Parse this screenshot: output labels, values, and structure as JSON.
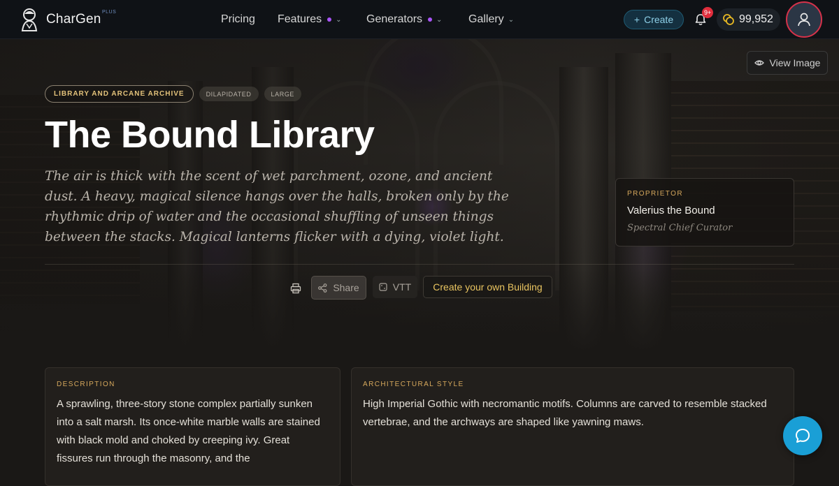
{
  "nav": {
    "logo_text": "CharGen",
    "logo_badge": "PLUS",
    "menu": [
      {
        "label": "Pricing"
      },
      {
        "label": "Features"
      },
      {
        "label": "Generators"
      },
      {
        "label": "Gallery"
      }
    ],
    "create_label": "Create",
    "notifications_badge": "9+",
    "coins": "99,952"
  },
  "hero": {
    "view_image_label": "View Image",
    "tags": [
      "LIBRARY AND ARCANE ARCHIVE",
      "DILAPIDATED",
      "LARGE"
    ],
    "title": "The Bound Library",
    "intro": "The air is thick with the scent of wet parchment, ozone, and ancient dust. A heavy, magical silence hangs over the halls, broken only by the rhythmic drip of water and the occasional shuffling of unseen things between the stacks. Magical lanterns flicker with a dying, violet light.",
    "proprietor": {
      "label": "PROPRIETOR",
      "name": "Valerius the Bound",
      "role": "Spectral Chief Curator"
    }
  },
  "actions": {
    "share_label": "Share",
    "vtt_label": "VTT",
    "create_own_label": "Create your own Building"
  },
  "sections": [
    {
      "label": "DESCRIPTION",
      "text": "A sprawling, three-story stone complex partially sunken into a salt marsh. Its once-white marble walls are stained with black mold and choked by creeping ivy. Great fissures run through the masonry, and the"
    },
    {
      "label": "ARCHITECTURAL STYLE",
      "text": "High Imperial Gothic with necromantic motifs. Columns are carved to resemble stacked vertebrae, and the archways are shaped like yawning maws."
    }
  ],
  "colors": {
    "accent_gold": "#d6a85c",
    "create_yellow": "#e9c460",
    "chat_blue": "#1a9fd6",
    "avatar_ring": "#d6324a",
    "feature_dot": "#a855f7"
  }
}
